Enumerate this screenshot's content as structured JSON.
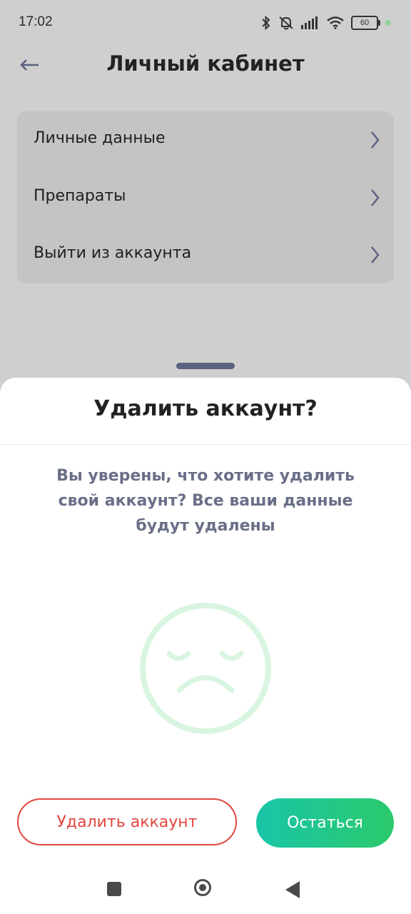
{
  "status_bar": {
    "time": "17:02",
    "battery": "60"
  },
  "header": {
    "title": "Личный кабинет"
  },
  "menu": {
    "items": [
      {
        "label": "Личные данные"
      },
      {
        "label": "Препараты"
      },
      {
        "label": "Выйти из аккаунта"
      }
    ]
  },
  "sheet": {
    "title": "Удалить аккаунт?",
    "message": "Вы уверены, что хотите удалить свой аккаунт? Все ваши данные будут удалены",
    "delete_label": "Удалить аккаунт",
    "stay_label": "Остаться"
  },
  "colors": {
    "accent_red": "#e2473f",
    "gradient_start": "#19c5a8",
    "gradient_end": "#2bc96a",
    "message_text": "#6a6f88",
    "face_color": "#d9f5e1"
  },
  "icons": [
    "back-arrow-icon",
    "chevron-right-icon",
    "sad-face-icon",
    "bluetooth-icon",
    "muted-bell-icon",
    "signal-icon",
    "wifi-icon",
    "battery-icon"
  ]
}
